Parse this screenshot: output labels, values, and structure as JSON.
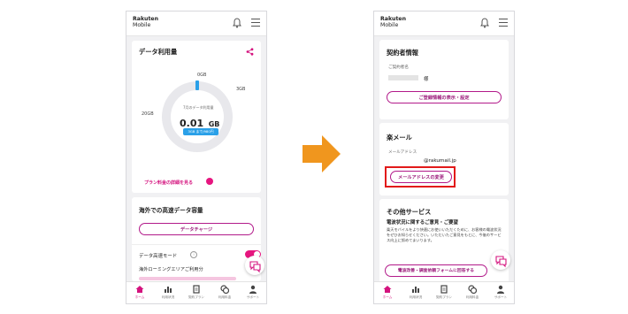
{
  "left": {
    "logo_line1": "Rakuten",
    "logo_line2": "Mobile",
    "data_title": "データ利用量",
    "gauge_top": "0GB",
    "gauge_right": "3GB",
    "gauge_left": "20GB",
    "month_label": "7月のデータ利用量",
    "usage_value": "0.01",
    "usage_unit": "GB",
    "price_badge": "3GB まで/980円",
    "plan_link": "プラン料金の詳細を見る",
    "overseas_title": "海外での高速データ容量",
    "charge_button": "データチャージ",
    "mode_label": "データ高速モード",
    "roaming_label": "海外ローミングエリアご利用分"
  },
  "right": {
    "logo_line1": "Rakuten",
    "logo_line2": "Mobile",
    "contract_title": "契約者情報",
    "contract_name_label": "ご契約者名",
    "honorific": "様",
    "contract_button": "ご登録情報の表示・設定",
    "mail_title": "楽メール",
    "mail_address_label": "メールアドレス",
    "mail_address": "@rakumail.jp",
    "mail_change_button": "メールアドレスの変更",
    "other_title": "その他サービス",
    "survey_title": "電波状況に関するご意見・ご要望",
    "survey_text": "楽天モバイルをより快適にお使いいただくために、お客様の電波状況をぜひお知らせください。いただいたご意見をもとに、今後のサービス向上に努めてまいります。",
    "survey_button": "電波改善・調査依頼フォームに回答する"
  },
  "tabs": [
    "ホーム",
    "利用状況",
    "契約プラン",
    "利用料金",
    "サポート"
  ],
  "colors": {
    "accent": "#d4137e",
    "highlight": "#e21a1a",
    "arrow": "#f0961e",
    "gauge": "#2aa0e8"
  }
}
